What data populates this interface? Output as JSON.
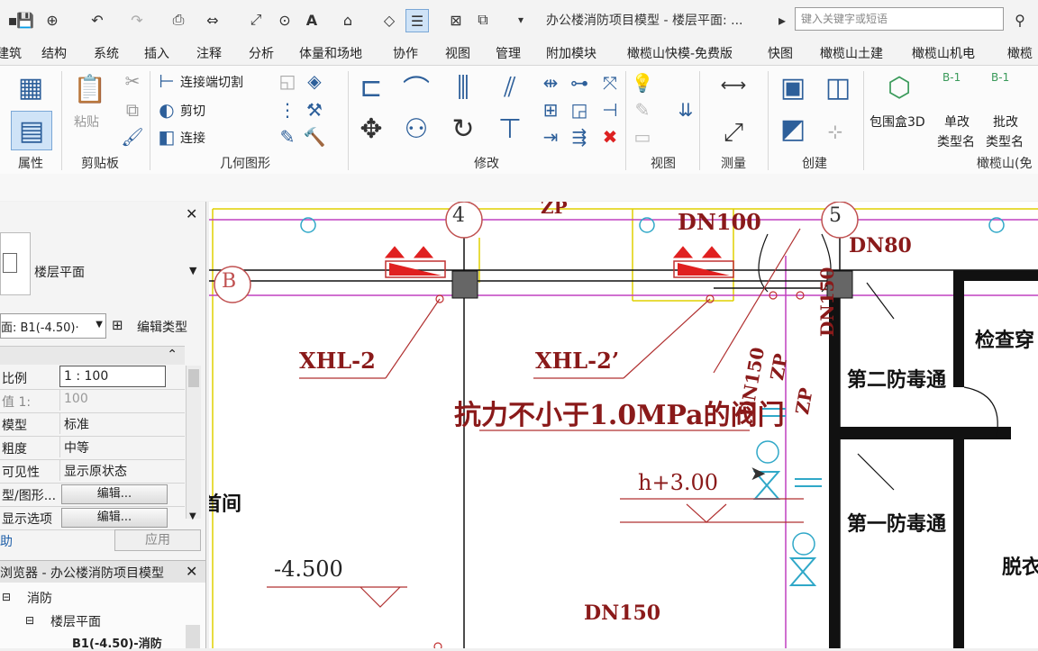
{
  "window": {
    "title": "办公楼消防项目模型 - 楼层平面: ...",
    "search_placeholder": "键入关键字或短语"
  },
  "tabs": [
    "建筑",
    "结构",
    "系统",
    "插入",
    "注释",
    "分析",
    "体量和场地",
    "协作",
    "视图",
    "管理",
    "附加模块",
    "橄榄山快模-免费版",
    "快图",
    "橄榄山土建",
    "橄榄山机电",
    "橄榄"
  ],
  "ribbon": {
    "properties_label": "属性",
    "paste_label": "粘贴",
    "clipboard_label": "剪贴板",
    "geometry": {
      "cut_join_ends": "连接端切割",
      "cut": "剪切",
      "join": "连接",
      "panel_label": "几何图形"
    },
    "modify_label": "修改",
    "view_label": "视图",
    "measure_label": "测量",
    "create_label": "创建",
    "bbox3d_label": "包围盒3D",
    "rename_type_single": [
      "单改",
      "类型名"
    ],
    "rename_type_batch": [
      "批改",
      "类型名"
    ],
    "olive_panel_label": "橄榄山(免",
    "bbox_tags": [
      "B-1",
      "B-1"
    ]
  },
  "properties": {
    "type_name": "楼层平面",
    "view_selector": "面: B1(-4.50)·",
    "edit_type": "编辑类型",
    "rows": [
      {
        "label": "比例",
        "value": "1 : 100"
      },
      {
        "label": "值 1:",
        "value": "100"
      },
      {
        "label": "模型",
        "value": "标准"
      },
      {
        "label": "粗度",
        "value": "中等"
      },
      {
        "label": "可见性",
        "value": "显示原状态"
      },
      {
        "label": "型/图形...",
        "value": "编辑..."
      },
      {
        "label": "显示选项",
        "value": "编辑..."
      }
    ],
    "help_link": "助",
    "apply": "应用"
  },
  "browser": {
    "title": "浏览器 - 办公楼消防项目模型",
    "items": [
      "消防",
      "楼层平面",
      "B1(-4.50)-消防"
    ]
  },
  "drawing": {
    "grid_labels": [
      "4",
      "5",
      "B"
    ],
    "pipe_labels": [
      "ZP",
      "DN100",
      "DN80",
      "DN150",
      "DN150",
      "ZP",
      "ZP",
      "DN150"
    ],
    "hydrant_tags": [
      "XHL-2",
      "XHL-2’"
    ],
    "note": "抗力不小于1.0MPa的阀门",
    "elevation_pipe": "h+3.00",
    "elevation_floor": "-4.500",
    "rooms": [
      "检查穿",
      "第二防毒通",
      "第一防毒通",
      "脱衣"
    ],
    "partial_room": "首间"
  }
}
